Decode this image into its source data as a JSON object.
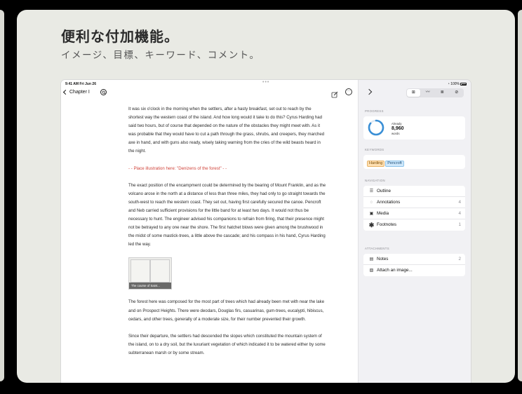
{
  "promo": {
    "headline": "便利な付加機能。",
    "subhead": "イメージ、目標、キーワード、コメント。"
  },
  "status_bar": {
    "time": "9:41 AM  Fri Jun 26",
    "dots": "•••",
    "battery": "100%"
  },
  "toolbar": {
    "back_label": "Chapter I"
  },
  "document": {
    "paragraphs": [
      "It was six o'clock in the morning when the settlers, after a hasty breakfast, set out to reach by the shortest way the western coast of the island. And how long would it take to do this? Cyrus Harding had said two hours, but of course that depended on the nature of the obstacles they might meet with. As it was probable that they would have to cut a path through the grass, shrubs, and creepers, they marched axe in hand, and with guns also ready, wisely taking warning from the cries of the wild beasts heard in the night.",
      "The exact position of the encampment could be determined by the bearing of Mount Franklin, and as the volcano arose in the north at a distance of less than three miles, they had only to go straight towards the south-west to reach the western coast. They set out, having first carefully secured the canoe. Pencroft and Neb carried sufficient provisions for the little band for at least two days. It would not thus be necessary to hunt. The engineer advised his companions to refrain from firing, that their presence might not be betrayed to any one near the shore. The first hatchet blows were given among the brushwood in the midst of some mastick-trees, a little above the cascade; and his compass in his hand, Cyrus Harding led the way.",
      "The forest here was composed for the most part of trees which had already been met with near the lake and on Prospect Heights. There were deodars, Douglas firs, casuarinas, gum-trees, eucalypti, hibiscus, cedars, and other trees, generally of a moderate size, for their number prevented their growth.",
      "Since their departure, the settlers had descended the slopes which constituted the mountain system of the island, on to a dry soil, but the luxuriant vegetation of which indicated it to be watered either by some subterranean marsh or by some stream."
    ],
    "annotation": "- - Place illustration here: \"Denizens of the forest\" - -",
    "image_caption": "The course of Saint..."
  },
  "inspector": {
    "tabs": [
      "⊞",
      "〰",
      "≣",
      "⊘"
    ],
    "active_tab": 0,
    "progress": {
      "section_label": "PROGRESS",
      "status": "Already",
      "count": "8,960",
      "unit": "words",
      "fraction": 0.85,
      "ring_color": "#3a8fd6"
    },
    "keywords": {
      "section_label": "KEYWORDS",
      "items": [
        {
          "label": "Harding",
          "color": "orange"
        },
        {
          "label": "Pencroft",
          "color": "blue"
        }
      ]
    },
    "navigation": {
      "section_label": "NAVIGATION",
      "items": [
        {
          "label": "Outline",
          "icon": "list-icon",
          "count": ""
        },
        {
          "label": "Annotations",
          "icon": "speech-bubble-icon",
          "count": "4"
        },
        {
          "label": "Media",
          "icon": "photo-icon",
          "count": "4"
        },
        {
          "label": "Footnotes",
          "icon": "asterisk-icon",
          "count": "1"
        }
      ]
    },
    "attachments": {
      "section_label": "ATTACHMENTS",
      "items": [
        {
          "label": "Notes",
          "icon": "document-icon",
          "count": "2"
        },
        {
          "label": "Attach an image...",
          "icon": "image-icon",
          "count": ""
        }
      ]
    }
  }
}
